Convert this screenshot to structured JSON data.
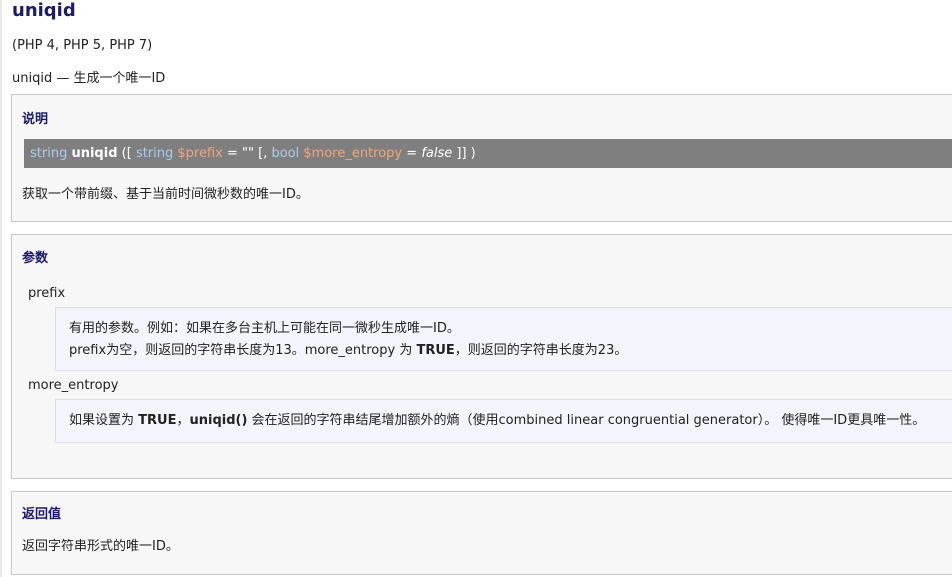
{
  "title": "uniqid",
  "versions": "(PHP 4, PHP 5, PHP 7)",
  "refname": "uniqid — 生成一个唯一ID",
  "description": {
    "heading": "说明",
    "signature": {
      "ret_type": "string",
      "name": "uniqid",
      "open": " ([ ",
      "p1_type": "string",
      "p1_name": "$prefix",
      "p1_default": " = \"\" [, ",
      "p2_type": "bool",
      "p2_name": "$more_entropy",
      "eq": " = ",
      "p2_default": "false",
      "close": " ]] )"
    },
    "text": "获取一个带前缀、基于当前时间微秒数的唯一ID。"
  },
  "parameters": {
    "heading": "参数",
    "items": [
      {
        "name": "prefix",
        "line1": "有用的参数。例如：如果在多台主机上可能在同一微秒生成唯一ID。",
        "line2_a": "prefix为空，则返回的字符串长度为13。more_entropy 为 ",
        "line2_b": "TRUE",
        "line2_c": "，则返回的字符串长度为23。"
      },
      {
        "name": "more_entropy",
        "a": "如果设置为 ",
        "b": "TRUE",
        "c": "，",
        "d": "uniqid()",
        "e": " 会在返回的字符串结尾增加额外的熵（使用combined linear congruential generator）。 使得唯一ID更具唯一性。"
      }
    ]
  },
  "returns": {
    "heading": "返回值",
    "text": "返回字符串形式的唯一ID。"
  }
}
